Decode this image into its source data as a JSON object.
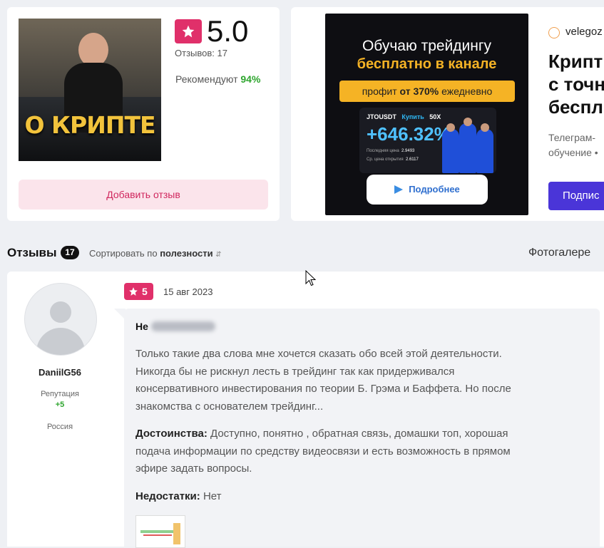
{
  "product": {
    "image_caption": "О КРИПТЕ",
    "rating": "5.0",
    "reviews_count_label": "Отзывов: 17",
    "recommend_label": "Рекомендуют",
    "recommend_value": "94%",
    "add_review_label": "Добавить отзыв"
  },
  "ad": {
    "line1": "Обучаю трейдингу",
    "line2": "бесплатно в канале",
    "pill_prefix": "профит",
    "pill_bold": "от 370%",
    "pill_suffix": "ежедневно",
    "ticker": "JTOUSDT",
    "buy": "Купить",
    "leverage": "50X",
    "percent": "+646.32%",
    "last_price_label": "Последняя цена",
    "last_price": "2.9493",
    "open_price_label": "Ср. цена открытия",
    "open_price": "2.6117",
    "button_label": "Подробнее",
    "brand": "velegoz",
    "title_lines": [
      "Крипт",
      "с точн",
      "беспл"
    ],
    "desc_lines": [
      "Телеграм-",
      "обучение •"
    ],
    "subscribe_label": "Подпис"
  },
  "reviews_header": {
    "title": "Отзывы",
    "count": "17",
    "sort_prefix": "Сортировать по",
    "sort_value": "полезности",
    "gallery": "Фотогалере"
  },
  "review": {
    "author": "DaniilG56",
    "reputation_label": "Репутация",
    "reputation_value": "+5",
    "country": "Россия",
    "score": "5",
    "date": "15 авг 2023",
    "title_prefix": "Не",
    "body_lines": [
      "Только такие два слова мне хочется сказать обо всей этой деятельности.",
      "Никогда бы не рискнул лесть в трейдинг так как придерживался",
      "консервативного инвестирования по теории Б. Грэма и Баффета. Но после",
      "знакомства с основателем трейдинг..."
    ],
    "pros_label": "Достоинства:",
    "pros_lines": [
      "Доступно, понятно , обратная связь, домашки топ, хорошая",
      "подача информации по средству видеосвязи и есть возможность в прямом",
      "эфире задать вопросы."
    ],
    "cons_label": "Недостатки:",
    "cons_text": "Нет"
  },
  "colors": {
    "accent_pink": "#e0306a",
    "green": "#2ea52e",
    "purple": "#4a35d8",
    "gold": "#f5b325"
  }
}
